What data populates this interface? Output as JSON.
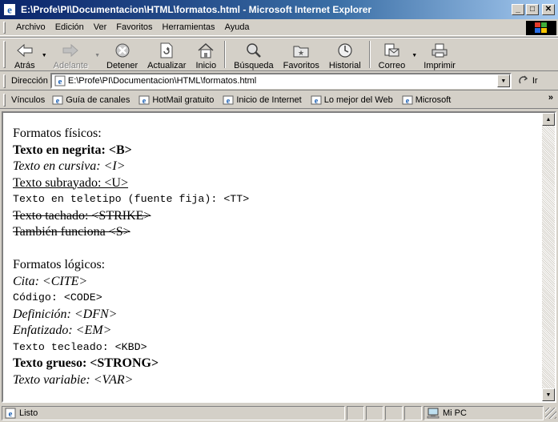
{
  "window": {
    "title": "E:\\Profe\\PI\\Documentacion\\HTML\\formatos.html - Microsoft Internet Explorer",
    "minimize": "_",
    "maximize": "□",
    "close": "✕"
  },
  "menu": {
    "items": [
      {
        "label": "Archivo",
        "access": "A"
      },
      {
        "label": "Edición",
        "access": "E"
      },
      {
        "label": "Ver",
        "access": "V"
      },
      {
        "label": "Favoritos",
        "access": "F"
      },
      {
        "label": "Herramientas",
        "access": "H"
      },
      {
        "label": "Ayuda",
        "access": "y"
      }
    ]
  },
  "toolbar": {
    "back_label": "Atrás",
    "forward_label": "Adelante",
    "stop_label": "Detener",
    "refresh_label": "Actualizar",
    "home_label": "Inicio",
    "search_label": "Búsqueda",
    "favorites_label": "Favoritos",
    "history_label": "Historial",
    "mail_label": "Correo",
    "print_label": "Imprimir"
  },
  "address": {
    "label": "Dirección",
    "value": "E:\\Profe\\PI\\Documentacion\\HTML\\formatos.html",
    "go_label": "Ir"
  },
  "links": {
    "label": "Vínculos",
    "items": [
      "Guía de canales",
      "HotMail gratuito",
      "Inicio de Internet",
      "Lo mejor del Web",
      "Microsoft"
    ]
  },
  "document": {
    "physical_heading": "Formatos físicos:",
    "bold": "Texto en negrita: <B>",
    "italic": "Texto en cursiva: <I>",
    "underline": "Texto subrayado: <U>",
    "teletype": "Texto en teletipo (fuente fija): <TT>",
    "strike": "Texto tachado: <STRIKE>",
    "strike_s": "También funciona <S>",
    "logical_heading": "Formatos lógicos:",
    "cite": "Cita: <CITE>",
    "code": "Código: <CODE>",
    "dfn": "Definición: <DFN>",
    "em": "Enfatizado: <EM>",
    "kbd": "Texto tecleado: <KBD>",
    "strong": "Texto grueso: <STRONG>",
    "var": "Texto variabie: <VAR>"
  },
  "status": {
    "text": "Listo",
    "zone": "Mi PC"
  },
  "colors": {
    "title_start": "#0a246a",
    "title_end": "#a6caf0",
    "chrome": "#d4d0c8"
  }
}
